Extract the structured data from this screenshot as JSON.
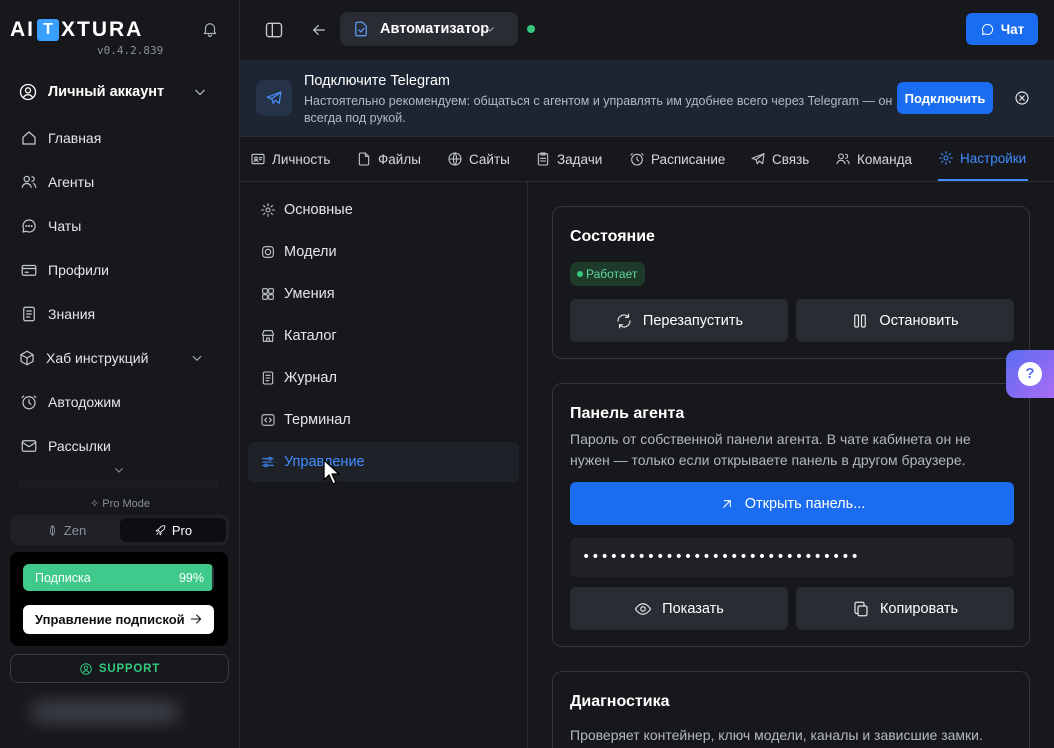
{
  "app": {
    "logo_pre": "AI",
    "logo_box": "T",
    "logo_post": "XTURA",
    "version": "v0.4.2.839"
  },
  "sidebar": {
    "account_label": "Личный аккаунт",
    "items": [
      {
        "label": "Главная",
        "icon": "home-icon"
      },
      {
        "label": "Агенты",
        "icon": "agents-icon"
      },
      {
        "label": "Чаты",
        "icon": "chat-icon"
      },
      {
        "label": "Профили",
        "icon": "profile-card-icon"
      },
      {
        "label": "Знания",
        "icon": "book-icon"
      },
      {
        "label": "Хаб инструкций",
        "icon": "hub-icon"
      },
      {
        "label": "Автодожим",
        "icon": "clock-icon"
      },
      {
        "label": "Рассылки",
        "icon": "mail-icon"
      }
    ],
    "pro_mode_label": "Pro Mode",
    "mode_zen": "Zen",
    "mode_pro": "Pro",
    "subscription_label": "Подписка",
    "subscription_percent_text": "99%",
    "subscription_fraction": 0.99,
    "subscription_manage": "Управление подпиской",
    "support_label": "SUPPORT"
  },
  "topbar": {
    "agent_name": "Автоматизатор",
    "chat_button": "Чат"
  },
  "banner": {
    "title": "Подключите Telegram",
    "description": "Настоятельно рекомендуем: общаться с агентом и управлять им удобнее всего через Telegram — он всегда под рукой.",
    "connect_button": "Подключить"
  },
  "tabs": [
    {
      "label": "Личность",
      "icon": "persona-icon"
    },
    {
      "label": "Файлы",
      "icon": "file-icon"
    },
    {
      "label": "Сайты",
      "icon": "globe-icon"
    },
    {
      "label": "Задачи",
      "icon": "tasks-icon"
    },
    {
      "label": "Расписание",
      "icon": "clock-icon"
    },
    {
      "label": "Связь",
      "icon": "send-icon"
    },
    {
      "label": "Команда",
      "icon": "team-icon"
    },
    {
      "label": "Настройки",
      "icon": "gear-icon",
      "active": true
    }
  ],
  "settings_nav": [
    {
      "label": "Основные",
      "icon": "gear-icon"
    },
    {
      "label": "Модели",
      "icon": "model-icon"
    },
    {
      "label": "Умения",
      "icon": "grid-icon"
    },
    {
      "label": "Каталог",
      "icon": "store-icon"
    },
    {
      "label": "Журнал",
      "icon": "log-icon"
    },
    {
      "label": "Терминал",
      "icon": "terminal-icon"
    },
    {
      "label": "Управление",
      "icon": "sliders-icon",
      "active": true
    }
  ],
  "status_card": {
    "title": "Состояние",
    "badge": "Работает",
    "restart": "Перезапустить",
    "stop": "Остановить"
  },
  "panel_card": {
    "title": "Панель агента",
    "description": "Пароль от собственной панели агента. В чате кабинета он не нужен — только если открываете панель в другом браузере.",
    "open_button": "Открыть панель...",
    "password_masked": "••••••••••••••••••••••••••••••",
    "show_button": "Показать",
    "copy_button": "Копировать"
  },
  "diag_card": {
    "title": "Диагностика",
    "description": "Проверяет контейнер, ключ модели, каналы и зависшие замки."
  },
  "colors": {
    "accent": "#1a6cf0",
    "status_green": "#34c97f",
    "background": "#17181c"
  }
}
